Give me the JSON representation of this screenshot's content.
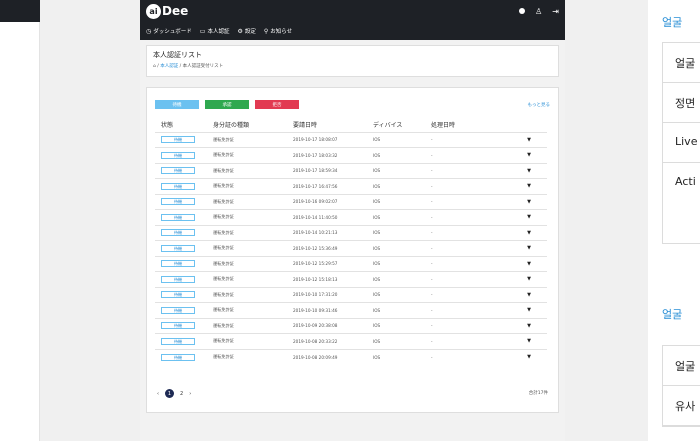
{
  "app": {
    "logo_prefix": "ai",
    "logo_text": "Dee",
    "nav": [
      "ダッシュボード",
      "本人認証",
      "設定",
      "お知らせ"
    ],
    "page_title": "本人認証リスト",
    "breadcrumb": [
      "本人認証",
      "本人認証受付リスト"
    ]
  },
  "filters": {
    "wait": "待機",
    "approve": "承認",
    "reject": "拒否",
    "more": "もっと見る"
  },
  "table": {
    "headers": [
      "状態",
      "身分証の種類",
      "要請日時",
      "ディバイス",
      "処理日時",
      ""
    ],
    "rows": [
      {
        "status": "待機",
        "type": "運転免許証",
        "date": "2019-10-17 18:08:07",
        "device": "IOS",
        "proc": "-"
      },
      {
        "status": "待機",
        "type": "運転免許証",
        "date": "2019-10-17 18:03:32",
        "device": "IOS",
        "proc": "-"
      },
      {
        "status": "待機",
        "type": "運転免許証",
        "date": "2019-10-17 18:59:34",
        "device": "IOS",
        "proc": "-"
      },
      {
        "status": "待機",
        "type": "運転免許証",
        "date": "2019-10-17 16:47:56",
        "device": "IOS",
        "proc": "-"
      },
      {
        "status": "待機",
        "type": "運転免許証",
        "date": "2019-10-16 09:02:07",
        "device": "IOS",
        "proc": "-"
      },
      {
        "status": "待機",
        "type": "運転免許証",
        "date": "2019-10-14 11:40:50",
        "device": "IOS",
        "proc": "-"
      },
      {
        "status": "待機",
        "type": "運転免許証",
        "date": "2019-10-14 10:21:13",
        "device": "IOS",
        "proc": "-"
      },
      {
        "status": "待機",
        "type": "運転免許証",
        "date": "2019-10-12 15:36:49",
        "device": "IOS",
        "proc": "-"
      },
      {
        "status": "待機",
        "type": "運転免許証",
        "date": "2019-10-12 15:29:57",
        "device": "IOS",
        "proc": "-"
      },
      {
        "status": "待機",
        "type": "運転免許証",
        "date": "2019-10-12 15:18:13",
        "device": "IOS",
        "proc": "-"
      },
      {
        "status": "待機",
        "type": "運転免許証",
        "date": "2019-10-10 17:31:20",
        "device": "IOS",
        "proc": "-"
      },
      {
        "status": "待機",
        "type": "運転免許証",
        "date": "2019-10-10 09:31:46",
        "device": "IOS",
        "proc": "-"
      },
      {
        "status": "待機",
        "type": "運転免許証",
        "date": "2019-10-09 20:38:08",
        "device": "IOS",
        "proc": "-"
      },
      {
        "status": "待機",
        "type": "運転免許証",
        "date": "2019-10-08 20:33:22",
        "device": "IOS",
        "proc": "-"
      },
      {
        "status": "待機",
        "type": "運転免許証",
        "date": "2019-10-08 20:09:49",
        "device": "IOS",
        "proc": "-"
      }
    ]
  },
  "pager": {
    "prev": "‹",
    "pages": [
      "1",
      "2"
    ],
    "next": "›",
    "total": "合計17件"
  },
  "right": {
    "heading1": "얼굴 ",
    "rows1": [
      "얼굴",
      "정면",
      "Live",
      "Acti"
    ],
    "heading2": "얼굴 ",
    "rows2": [
      "얼굴",
      "유사"
    ]
  },
  "colors": {
    "dark": "#1e2126",
    "wait": "#6cc1f0",
    "approve": "#2fa84f",
    "reject": "#e23a52",
    "link": "#2a8fd6"
  }
}
